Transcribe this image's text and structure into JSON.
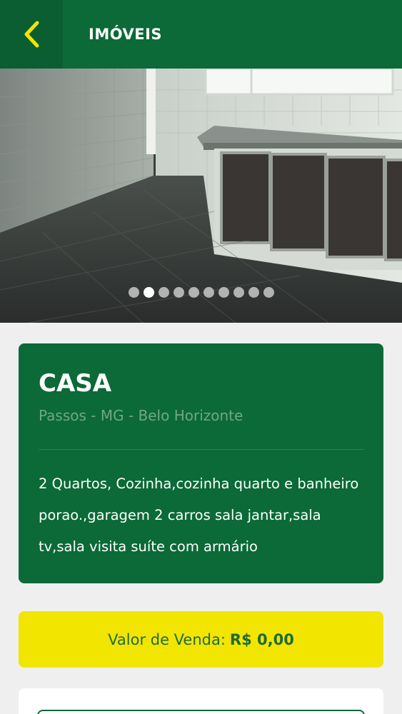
{
  "header": {
    "title": "IMÓVEIS",
    "back_icon": "chevron-left-icon",
    "accent_color": "#f2e500",
    "bar_color": "#0b6a37"
  },
  "carousel": {
    "image_description_icon": "property-photo",
    "total_images": 10,
    "active_index": 1
  },
  "listing": {
    "type": "CASA",
    "location": "Passos - MG - Belo Horizonte",
    "description": "2 Quartos, Cozinha,cozinha quarto e banheiro porao.,garagem 2 carros sala jantar,sala tv,sala visita suíte com armário"
  },
  "price": {
    "label": "Valor de Venda:",
    "value": "R$ 0,00"
  }
}
